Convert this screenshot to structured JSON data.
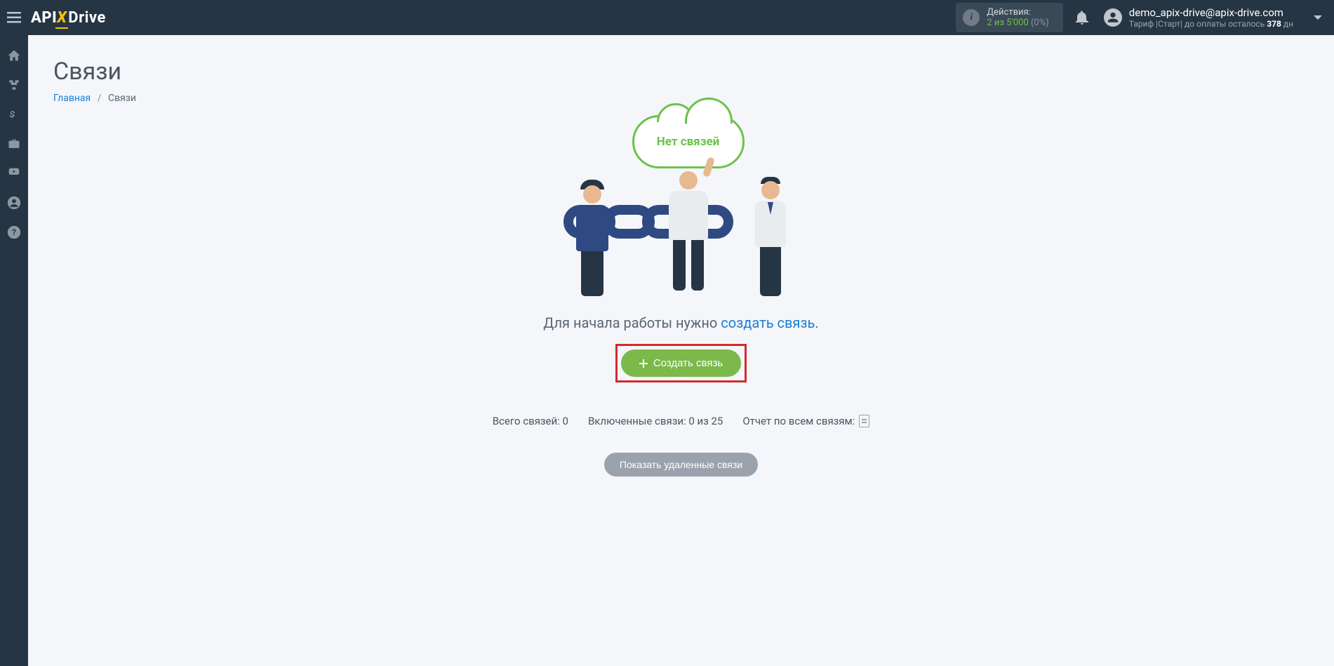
{
  "header": {
    "logo": {
      "part1": "API",
      "part2": "X",
      "part3": "Drive"
    },
    "actions": {
      "label": "Действия:",
      "count": "2",
      "of": " из ",
      "total": "5'000",
      "percent": " (0%)"
    },
    "user": {
      "email": "demo_apix-drive@apix-drive.com",
      "tariff_prefix": "Тариф |Старт| до оплаты осталось ",
      "tariff_days": "378",
      "tariff_suffix": " дн"
    }
  },
  "sidebar": {
    "items": [
      "home",
      "sitemap",
      "dollar",
      "briefcase",
      "youtube",
      "user",
      "help"
    ]
  },
  "page": {
    "title": "Связи",
    "breadcrumb": {
      "home": "Главная",
      "current": "Связи"
    },
    "cloud_text": "Нет связей",
    "intro_prefix": "Для начала работы нужно ",
    "intro_link": "создать связь",
    "intro_suffix": ".",
    "create_button": "Создать связь",
    "stats": {
      "total": "Всего связей: 0",
      "enabled": "Включенные связи: 0 из 25",
      "report": "Отчет по всем связям:"
    },
    "deleted_button": "Показать удаленные связи"
  }
}
